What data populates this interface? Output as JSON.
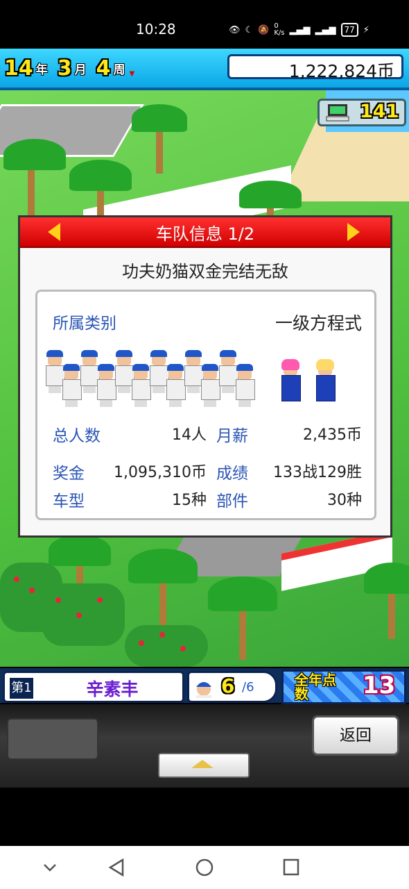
{
  "status": {
    "time": "10:28",
    "net_speed": "0\nK/s",
    "battery": "77"
  },
  "top": {
    "year": "14",
    "year_unit": "年",
    "month": "3",
    "month_unit": "月",
    "week": "4",
    "week_unit": "周",
    "money": "1,222,824币"
  },
  "counter": {
    "value": "141",
    "icon": "computer-icon"
  },
  "dialog": {
    "title": "车队信息 1/2",
    "team_name": "功夫奶猫双金完结无敌",
    "category_label": "所属类别",
    "category_value": "一级方程式",
    "stats": [
      {
        "label": "总人数",
        "value": "14人"
      },
      {
        "label": "月薪",
        "value": "2,435币"
      },
      {
        "label": "奖金",
        "value": "1,095,310币"
      },
      {
        "label": "成绩",
        "value": "133战129胜"
      },
      {
        "label": "车型",
        "value": "15种"
      },
      {
        "label": "部件",
        "value": "30种"
      }
    ]
  },
  "hud": {
    "rank_badge": "第1",
    "rank_name": "辛素丰",
    "staff_now": "6",
    "staff_total": "/6",
    "points_label": "全年点数",
    "points_value": "13"
  },
  "buttons": {
    "back": "返回"
  },
  "colors": {
    "accent_red": "#e00000",
    "label_blue": "#2a55b5",
    "yellow": "#ffe81a"
  }
}
